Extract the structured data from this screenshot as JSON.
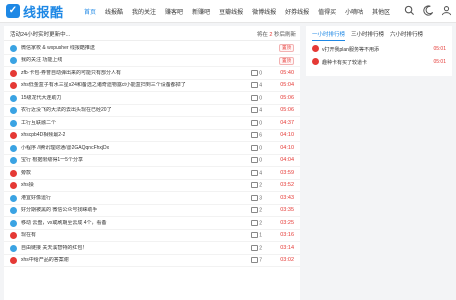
{
  "header": {
    "logo_text": "线报酷",
    "nav": [
      "首页",
      "线报酷",
      "我的关注",
      "赚客吧",
      "新赚吧",
      "豆瓣线报",
      "微博线报",
      "好券线报",
      "值得买",
      "小嘀咕",
      "其他区"
    ]
  },
  "main": {
    "title": "活动24小时实时更新中...",
    "refresh_prefix": "将在 ",
    "refresh_seconds": "2",
    "refresh_suffix": " 秒后刷新",
    "rows": [
      {
        "text": "微信家校 & wxpusher 线报酷推送",
        "tag": "置顶",
        "count": "",
        "time": "",
        "icon": "#3aa3e3"
      },
      {
        "text": "我的关注 功能上线",
        "tag": "置顶",
        "count": "",
        "time": "",
        "icon": "#3aa3e3"
      },
      {
        "text": "zfb·卡包-券誉自动弹出来的可能只有部分人有",
        "tag": "",
        "count": "0",
        "time": "05:40",
        "icon": "#e53935"
      },
      {
        "text": "xhs低金盒子有水三星s24和备选之诸奇遗物露ct小能盒扫到三个设备都掉了",
        "tag": "",
        "count": "4",
        "time": "05:04",
        "icon": "#e53935"
      },
      {
        "text": "15级龙代大连助力",
        "tag": "",
        "count": "0",
        "time": "05:06",
        "icon": "#3aa3e3"
      },
      {
        "text": "农行近没飞的大法的去出头现在已经20了",
        "tag": "",
        "count": "4",
        "time": "05:06",
        "icon": "#3aa3e3"
      },
      {
        "text": "工行互联融二个",
        "tag": "",
        "count": "0",
        "time": "04:37",
        "icon": "#3aa3e3"
      },
      {
        "text": "xhscpb4D相频最2-2",
        "tag": "",
        "count": "6",
        "time": "04:10",
        "icon": "#e53935"
      },
      {
        "text": "小程序 //腾讯理财通/@2GAQqncFhxjDx",
        "tag": "",
        "count": "0",
        "time": "04:10",
        "icon": "#3aa3e3"
      },
      {
        "text": "宝行 根据限级得1一5个分享",
        "tag": "",
        "count": "0",
        "time": "04:04",
        "icon": "#3aa3e3"
      },
      {
        "text": "旁款",
        "tag": "",
        "count": "4",
        "time": "03:59",
        "icon": "#e53935"
      },
      {
        "text": "xhs操",
        "tag": "",
        "count": "2",
        "time": "03:52",
        "icon": "#e53935"
      },
      {
        "text": "港宜好像运行",
        "tag": "",
        "count": "3",
        "time": "03:43",
        "icon": "#3aa3e3"
      },
      {
        "text": "好分期被黑的 微信公众号找睐助手",
        "tag": "",
        "count": "2",
        "time": "03:35",
        "icon": "#3aa3e3"
      },
      {
        "text": "移动 云盘，vx或刷期至云成 4个，看备",
        "tag": "",
        "count": "2",
        "time": "03:25",
        "icon": "#3aa3e3"
      },
      {
        "text": "现在有",
        "tag": "",
        "count": "1",
        "time": "03:16",
        "icon": "#e53935"
      },
      {
        "text": "自由链接 关天溪智特的红包！",
        "tag": "",
        "count": "2",
        "time": "03:14",
        "icon": "#3aa3e3"
      },
      {
        "text": "xhs中给产品的答案谢",
        "tag": "",
        "count": "7",
        "time": "03:02",
        "icon": "#e53935"
      }
    ]
  },
  "side": {
    "tabs": [
      "一小时排行榜",
      "三小时排行榜",
      "六小时排行榜"
    ],
    "rows": [
      {
        "text": "v打开我plan服务等不用添",
        "time": "05:01",
        "icon": "#e53935"
      },
      {
        "text": "趣种卡有买了较道卡",
        "time": "05:01",
        "icon": "#e53935"
      }
    ]
  }
}
